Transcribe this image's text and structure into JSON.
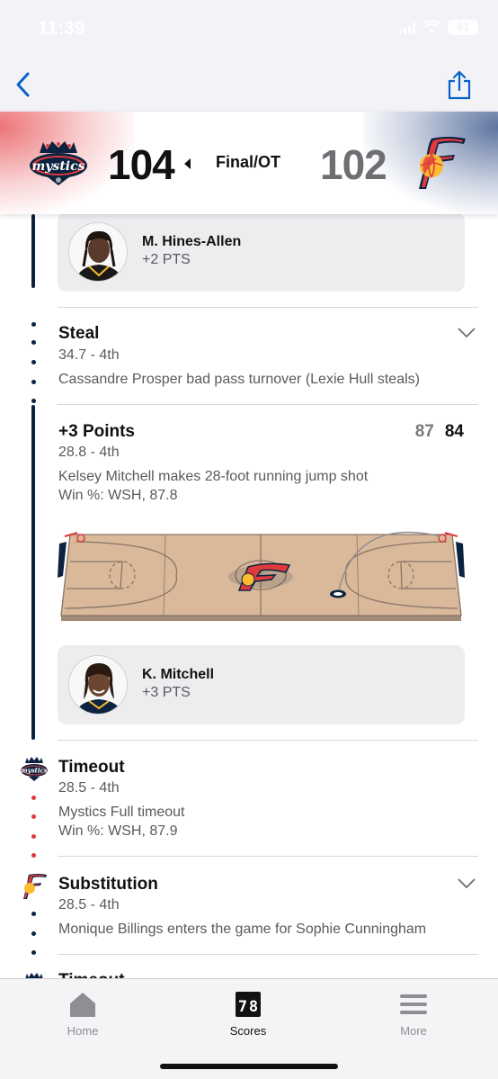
{
  "status_bar": {
    "time": "11:39",
    "battery": "93"
  },
  "header": {
    "home_team_logo": "mystics-logo",
    "away_team_logo": "fever-logo",
    "home_score": "104",
    "away_score": "102",
    "status": "Final/OT",
    "colors": {
      "home": "#e03a3e",
      "away": "#0c2340"
    }
  },
  "feed": {
    "top_player": {
      "name": "M. Hines-Allen",
      "pts": "+2 PTS"
    },
    "plays": [
      {
        "title": "Steal",
        "time": "34.7 - 4th",
        "desc": "Cassandre Prosper bad pass turnover (Lexie Hull steals)"
      },
      {
        "title": "+3 Points",
        "time": "28.8 - 4th",
        "desc": "Kelsey Mitchell makes 28-foot running jump shot",
        "win_prob": "Win %: WSH, 87.8",
        "score_home": "87",
        "score_away": "84",
        "player": {
          "name": "K. Mitchell",
          "pts": "+3 PTS"
        }
      },
      {
        "title": "Timeout",
        "time": "28.5 - 4th",
        "desc": "Mystics Full timeout",
        "win_prob": "Win %: WSH, 87.9"
      },
      {
        "title": "Substitution",
        "time": "28.5 - 4th",
        "desc": "Monique Billings enters the game for Sophie Cunningham"
      },
      {
        "title": "Timeout"
      }
    ]
  },
  "tabs": [
    {
      "label": "Home",
      "icon": "home-icon"
    },
    {
      "label": "Scores",
      "icon": "scores-icon"
    },
    {
      "label": "More",
      "icon": "menu-icon"
    }
  ]
}
